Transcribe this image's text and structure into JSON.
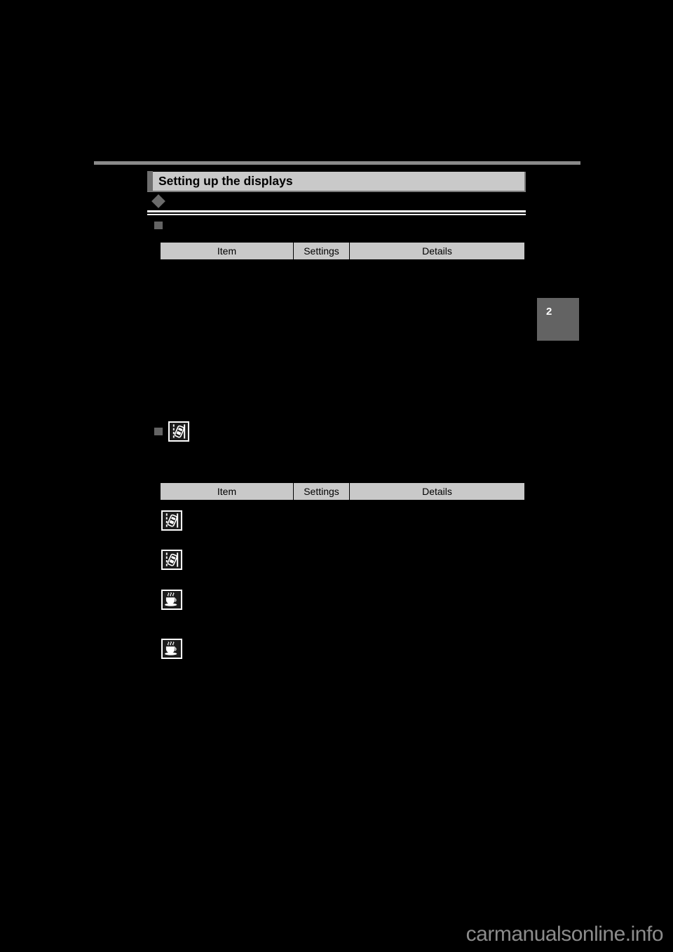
{
  "page": {
    "background_color": "#000000",
    "page_number": "2",
    "page_tab_color": "#636363"
  },
  "header": {
    "rule_color": "#8a8a8a"
  },
  "section": {
    "title": "Setting up the displays",
    "bar_color": "#c9c9c9",
    "accent_color": "#6f6f6f"
  },
  "bullets": {
    "diamond": {
      "name": "diamond-bullet",
      "color": "#6b6b6b",
      "text": ""
    },
    "square_1": {
      "name": "square-bullet",
      "color": "#646464",
      "text": ""
    },
    "square_2": {
      "name": "square-bullet",
      "color": "#646464",
      "text": ""
    }
  },
  "tables": [
    {
      "id": "table-1",
      "columns": [
        "Item",
        "Settings",
        "Details"
      ],
      "rows": []
    },
    {
      "id": "table-2",
      "columns": [
        "Item",
        "Settings",
        "Details"
      ],
      "rows": []
    }
  ],
  "icons": {
    "lane_departure": "lane-departure-alert-icon",
    "rest_reminder": "rest-reminder-coffee-cup-icon",
    "chip_background": "#1c1c1c",
    "chip_border": "#ffffff"
  },
  "icon_rows": [
    {
      "icon": "lane-departure-alert-icon",
      "text": ""
    },
    {
      "icon": "lane-departure-alert-icon",
      "text": ""
    },
    {
      "icon": "rest-reminder-coffee-cup-icon",
      "text": ""
    },
    {
      "icon": "rest-reminder-coffee-cup-icon",
      "text": ""
    }
  ],
  "heading_icon": {
    "icon": "lane-departure-alert-icon",
    "text": ""
  },
  "watermark": {
    "text": "carmanualsonline.info"
  }
}
